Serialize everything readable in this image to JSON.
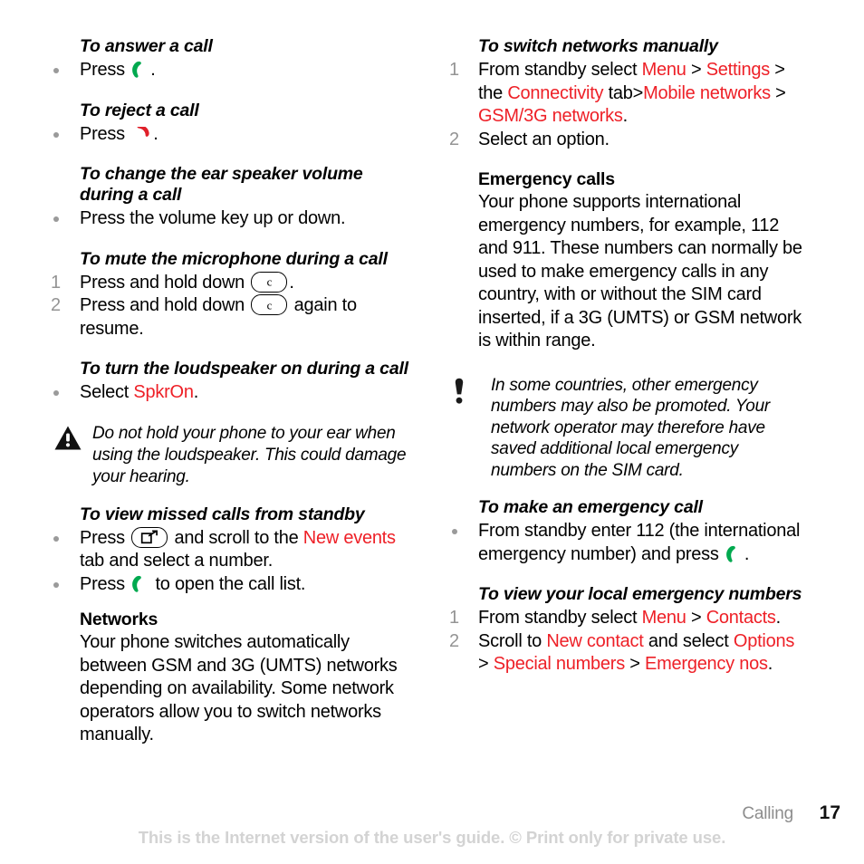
{
  "page": {
    "number": "17",
    "chapter": "Calling",
    "disclaimer": "This is the Internet version of the user's guide. © Print only for private use."
  },
  "colors": {
    "link_red": "#ee2027",
    "marker_gray": "#949494",
    "footer_gray": "#8d8d8d",
    "disclaimer_gray": "#d3d3d3",
    "call_green": "#00a94f",
    "end_red": "#e0202a"
  },
  "left_column": {
    "s1": {
      "heading": "To answer a call",
      "step1_pre": "Press ",
      "step1_post": "."
    },
    "s2": {
      "heading": "To reject a call",
      "step1_pre": "Press ",
      "step1_post": "."
    },
    "s3": {
      "heading": "To change the ear speaker volume during a call",
      "step1": "Press the volume key up or down."
    },
    "s4": {
      "heading": "To mute the microphone during a call",
      "marker1": "1",
      "marker2": "2",
      "step1_pre": "Press and hold down ",
      "key_label": "c",
      "step1_post": ".",
      "step2_pre": "Press and hold down ",
      "step2_post": " again to resume."
    },
    "s5": {
      "heading": "To turn the loudspeaker on during a call",
      "step1_pre": "Select ",
      "step1_link": "SpkrOn",
      "step1_post": "."
    },
    "warning": {
      "icon": "warning-triangle-icon",
      "text": "Do not hold your phone to your ear when using the loudspeaker. This could damage your hearing."
    },
    "s6": {
      "heading": "To view missed calls from standby",
      "step1_pre": "Press ",
      "key_label": "activity-menu",
      "step1_mid": " and scroll to the ",
      "step1_link": "New events",
      "step1_post": " tab and select a number.",
      "step2_pre": "Press ",
      "step2_post": " to open the call list."
    },
    "s7": {
      "heading": "Networks",
      "body": "Your phone switches automatically between GSM and 3G (UMTS) networks depending on availability. Some network operators allow you to switch networks manually."
    }
  },
  "right_column": {
    "s1": {
      "heading": "To switch networks manually",
      "marker1": "1",
      "marker2": "2",
      "step1_a": "From standby select ",
      "step1_link1": "Menu",
      "step1_gt1": " > ",
      "step1_link2": "Settings",
      "step1_b": "> the ",
      "step1_link3": "Connectivity",
      "step1_c": " tab",
      "step1_gt2": ">",
      "step1_link4": "Mobile networks",
      "step1_gt3": "> ",
      "step1_link5": "GSM/3G networks",
      "step1_d": ".",
      "step2": "Select an option."
    },
    "s2": {
      "heading": "Emergency calls",
      "body": "Your phone supports international emergency numbers, for example, 112 and 911. These numbers can normally be used to make emergency calls in any country, with or without the SIM card inserted, if a 3G (UMTS) or GSM network is within range."
    },
    "note": {
      "icon": "exclamation-note-icon",
      "text": "In some countries, other emergency numbers may also be promoted. Your network operator may therefore have saved additional local emergency numbers on the SIM card."
    },
    "s3": {
      "heading": "To make an emergency call",
      "step1_pre": "From standby enter 112 (the international emergency number) and press ",
      "step1_post": "."
    },
    "s4": {
      "heading": "To view your local emergency numbers",
      "marker1": "1",
      "marker2": "2",
      "step1_a": "From standby select ",
      "step1_link1": "Menu",
      "step1_gt1": " > ",
      "step1_link2": "Contacts",
      "step1_b": ".",
      "step2_a": "Scroll to ",
      "step2_link1": "New contact",
      "step2_b": " and select ",
      "step2_link2": "Options",
      "step2_gt1": " > ",
      "step2_link3": "Special numbers",
      "step2_gt2": "> ",
      "step2_link4": "Emergency nos",
      "step2_c": "."
    }
  }
}
